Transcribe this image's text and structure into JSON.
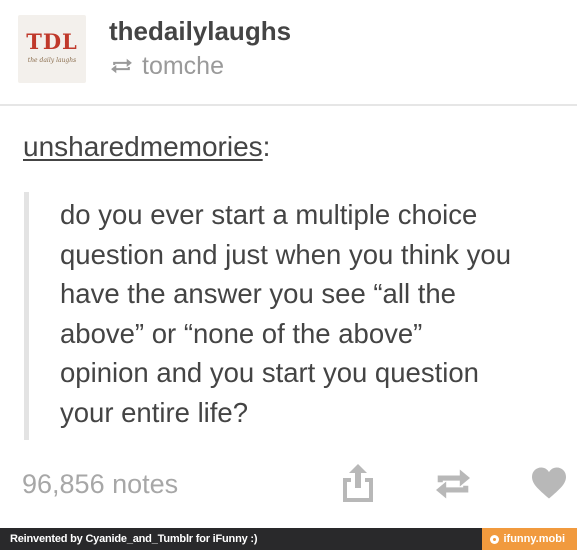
{
  "header": {
    "avatar": {
      "logo_text": "TDL",
      "logo_subtext": "the daily laughs"
    },
    "blog_name": "thedailylaughs",
    "reblogged_from": "tomche"
  },
  "post": {
    "source_user": "unsharedmemories",
    "source_suffix": ":",
    "quote_lines": [
      "do you ever start a multiple choice",
      "question and just when you think you",
      "have the answer you see “all the",
      "above” or “none of the above”",
      "opinion and you start you question",
      "your entire life?"
    ]
  },
  "actions": {
    "notes": "96,856 notes",
    "share_icon": "share-icon",
    "reblog_icon": "reblog-icon",
    "like_icon": "heart-icon"
  },
  "footer": {
    "credit": "Reinvented by Cyanide_and_Tumblr for iFunny :)",
    "site": "ifunny.mobi"
  },
  "colors": {
    "text": "#444444",
    "muted": "#a7a7a7",
    "icon": "#b8b8b8",
    "footer_bg": "#29292b",
    "footer_accent": "#f19a3e",
    "logo_red": "#c0392b"
  }
}
